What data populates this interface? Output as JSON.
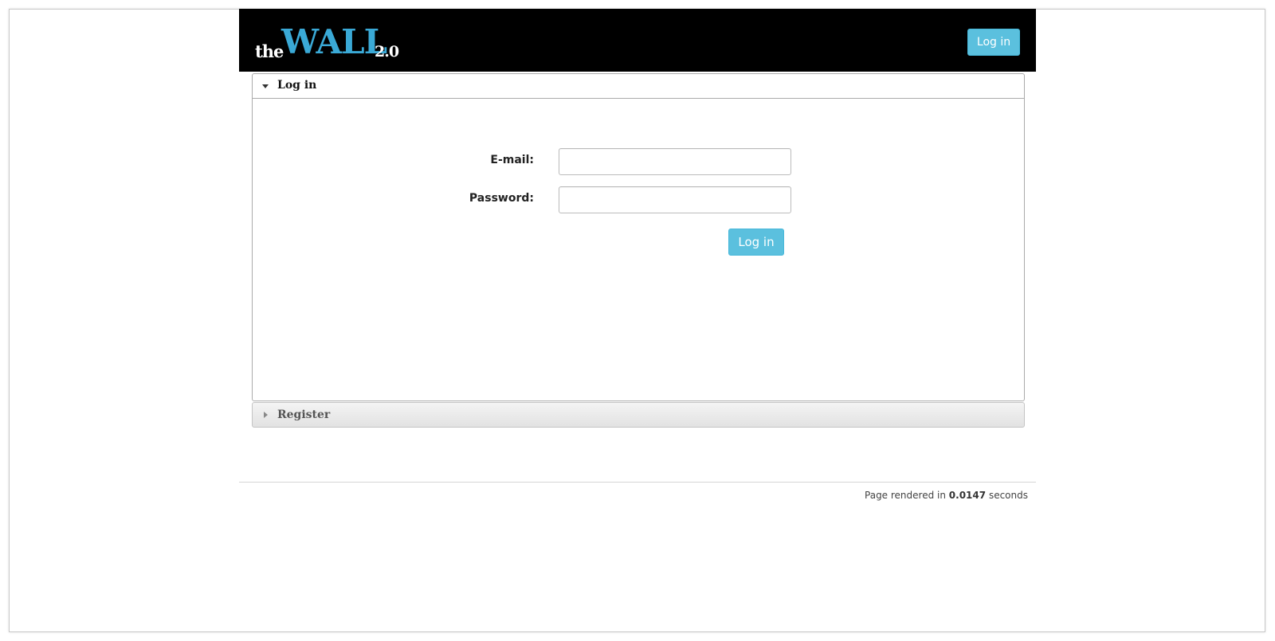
{
  "header": {
    "logo_the": "the",
    "logo_wall": "WALL",
    "logo_version": "2.0",
    "login_button": "Log in"
  },
  "login_panel": {
    "title": "Log in",
    "email_label": "E-mail:",
    "email_value": "",
    "password_label": "Password:",
    "password_value": "",
    "submit_label": "Log in"
  },
  "register_panel": {
    "title": "Register"
  },
  "footer": {
    "prefix": "Page rendered in",
    "time": "0.0147",
    "suffix": "seconds"
  },
  "colors": {
    "accent": "#5bc0de",
    "logo_blue": "#3aa9d6",
    "navbar": "#000000"
  },
  "icons": {
    "login_toggle": "caret-down-icon",
    "register_toggle": "caret-right-icon"
  }
}
